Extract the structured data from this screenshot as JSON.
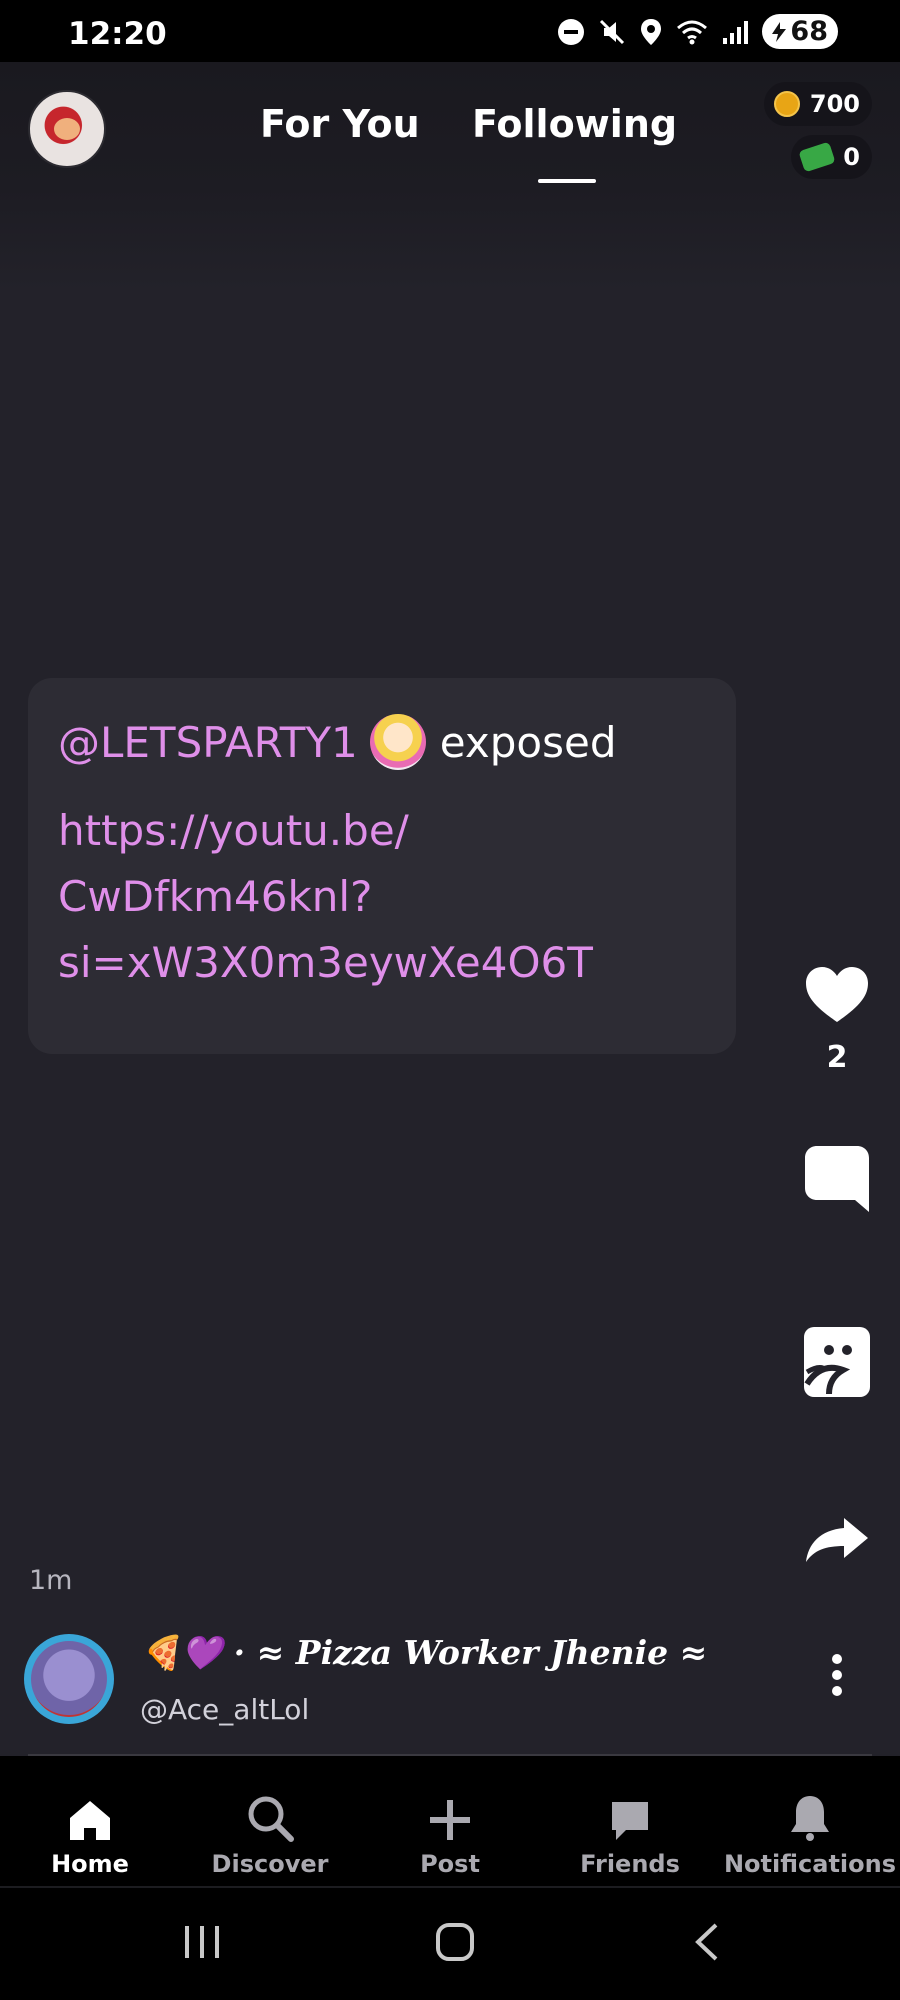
{
  "status_bar": {
    "time": "12:20",
    "battery": "68",
    "icons": [
      "dnd-icon",
      "mute-icon",
      "location-icon",
      "wifi-icon",
      "signal-icon",
      "battery-icon"
    ]
  },
  "header": {
    "tabs": [
      {
        "label": "For You",
        "active": false
      },
      {
        "label": "Following",
        "active": true
      }
    ],
    "coins": "700",
    "cash": "0"
  },
  "post": {
    "mention": "@LETSPARTY1",
    "verb": "exposed",
    "link": "https://youtu.be/CwDfkm46knl?si=xW3X0m3eywXe4O6T",
    "link_lines": [
      "https://youtu.be/",
      "CwDfkm46knl?",
      "si=xW3X0m3eywXe4O6T"
    ],
    "likes": "2",
    "time_ago": "1m",
    "author_display_name": "🍕💜 · ≈ Pizza Worker Jhenie ≈",
    "author_handle": "@Ace_altLol"
  },
  "actions": [
    "like-icon",
    "comment-icon",
    "remix-icon",
    "share-icon"
  ],
  "bottom_nav": [
    {
      "label": "Home",
      "icon": "home-icon",
      "active": true
    },
    {
      "label": "Discover",
      "icon": "search-icon",
      "active": false
    },
    {
      "label": "Post",
      "icon": "plus-icon",
      "active": false
    },
    {
      "label": "Friends",
      "icon": "chat-icon",
      "active": false
    },
    {
      "label": "Notifications",
      "icon": "bell-icon",
      "active": false
    }
  ],
  "colors": {
    "background": "#23222a",
    "card": "#2d2c34",
    "mention": "#df8fe9",
    "nav_bg": "#000000"
  }
}
